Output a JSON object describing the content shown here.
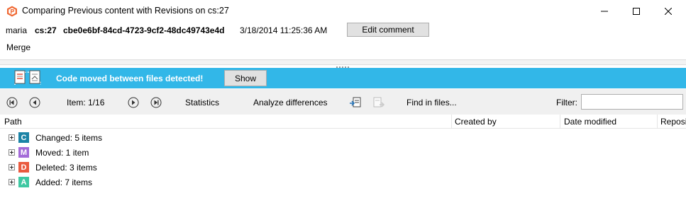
{
  "window": {
    "title": "Comparing Previous content with Revisions on cs:27",
    "controls": [
      "minimize-icon",
      "maximize-icon",
      "close-icon"
    ]
  },
  "changeset": {
    "user": "maria",
    "cs": "cs:27",
    "guid": "cbe0e6bf-84cd-4723-9cf2-48dc49743e4d",
    "date": "3/18/2014 11:25:36 AM",
    "edit_button": "Edit comment",
    "comment": "Merge"
  },
  "notification": {
    "icon": "files-moved-icon",
    "message": "Code moved between files detected!",
    "show_button": "Show",
    "color": "#32b7e8"
  },
  "toolbar": {
    "item_label": "Item: 1/16",
    "statistics": "Statistics",
    "analyze": "Analyze differences",
    "find": "Find in files...",
    "filter_label": "Filter:",
    "filter_value": ""
  },
  "columns": [
    "Path",
    "Created by",
    "Date modified",
    "Reposi"
  ],
  "tree": [
    {
      "letter": "C",
      "label": "Changed: 5 items",
      "color": "#1b83a6"
    },
    {
      "letter": "M",
      "label": "Moved: 1 item",
      "color": "#a36ad8"
    },
    {
      "letter": "D",
      "label": "Deleted: 3 items",
      "color": "#ea5b3f"
    },
    {
      "letter": "A",
      "label": "Added: 7 items",
      "color": "#3fc8a2"
    }
  ]
}
